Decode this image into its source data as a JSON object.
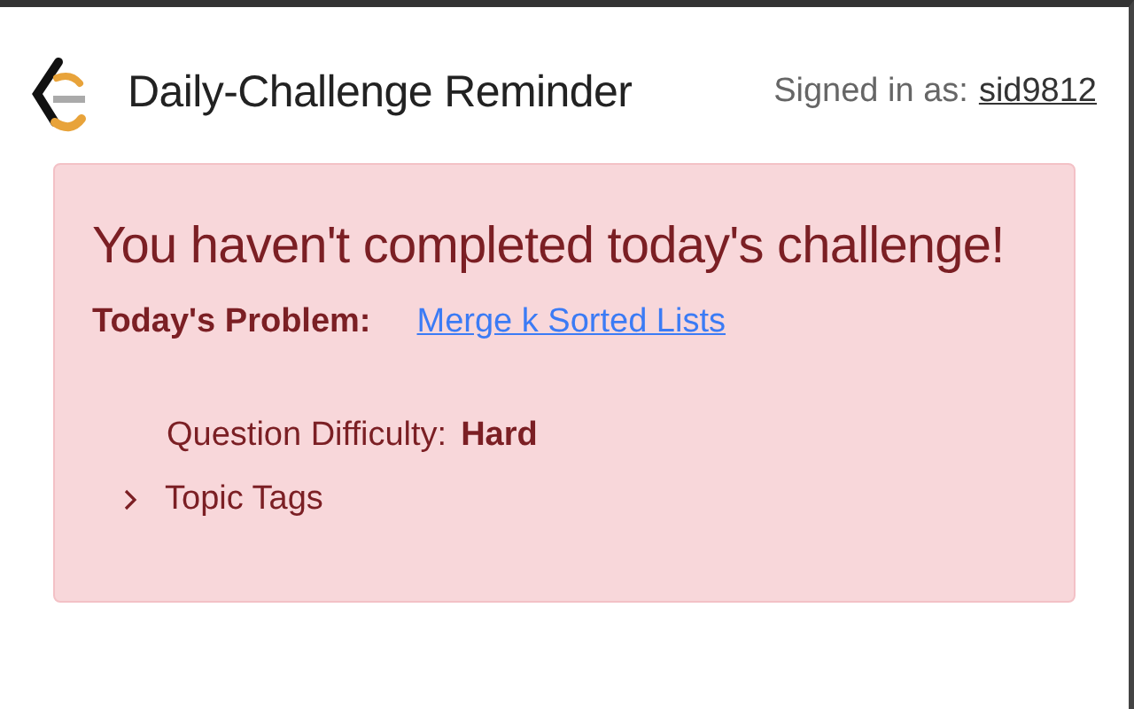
{
  "header": {
    "title": "Daily-Challenge Reminder",
    "signed_in_label": "Signed in as:",
    "username": "sid9812"
  },
  "alert": {
    "heading": "You haven't completed today's challenge!",
    "problem_label": "Today's Problem:",
    "problem_link": "Merge k Sorted Lists",
    "difficulty_label": "Question Difficulty:",
    "difficulty": "Hard",
    "topic_tags": {
      "label": "Topic Tags",
      "expanded": false
    }
  }
}
